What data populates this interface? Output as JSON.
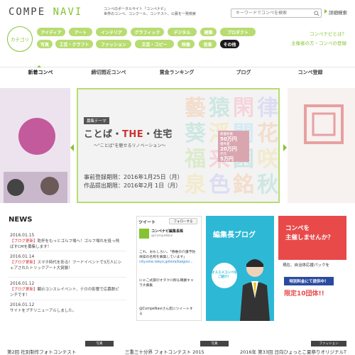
{
  "header": {
    "logo_main": "COMPE",
    "logo_accent": "NAVI",
    "tagline_1": "コンペのポータルサイト「コンペナビ」",
    "tagline_2": "世界のコンペ、コンクール、コンテスト、公募を一発検索",
    "search_placeholder": "キーワードでコンペを検索",
    "advanced_search": "詳細検索"
  },
  "category": {
    "label": "カテゴリ",
    "row1": [
      "アイディア",
      "アート",
      "インテリア",
      "グラフィック",
      "デジタル",
      "建築",
      "プロダクト"
    ],
    "row2": [
      "写真",
      "工芸・クラフト",
      "ファッション",
      "文芸・コピー",
      "映像",
      "音楽",
      "その他"
    ]
  },
  "side_links": {
    "about": "コンペナビとは？",
    "for_hosts": "主催者の方・コンペの登録"
  },
  "nav": [
    "新着コンペ",
    "締切間近コンペ",
    "賞金ランキング",
    "ブログ",
    "コンペ登録"
  ],
  "hero": {
    "tag": "募集テーマ",
    "title_a": "ことば",
    "title_b": "THE",
    "title_c": "住宅",
    "subtitle": "〜\"ことば\"を魅せるリノベーション〜",
    "date_1": "事前登録期限：2016年1月25日（月）",
    "date_2": "作品提出期限：2016年2月 1日（月）",
    "prize_1": "最優秀賞",
    "prize_1_val": "50万円",
    "prize_2": "優秀賞",
    "prize_2_val": "20万円",
    "prize_3": "佳作",
    "prize_3_val": "5万円"
  },
  "news": {
    "heading": "NEWS",
    "items": [
      {
        "date": "2016.01.15",
        "cat": "【ブログ更新】",
        "text": "乾杯をもっとゴルフ場へ！ゴルフ場れを投っ飛ばすCMを募集します！"
      },
      {
        "date": "2016.01.14",
        "cat": "【ブログ更新】",
        "text": "スマホ時代を彩る！フードイベントで3万人にシェアされたトリックアート大賞展！"
      },
      {
        "date": "2016.01.12",
        "cat": "【ブログ更新】",
        "text": "顕示コンスレイベント、テロの影響で応募数ピンチです！"
      },
      {
        "date": "2016.01.12",
        "cat": "",
        "text": "サイトをプチリニューアルしました。"
      }
    ]
  },
  "tweets": {
    "heading": "ツイート",
    "follow": "フォローする",
    "name": "コンペナビ編集長株",
    "handle": "@CompeNavi",
    "body": "これ、おもしろい。「香椎の介護予防体操の名称を募集しています」",
    "link": "city.ome.tokyo.jp/kore/kaigosi...",
    "retweet": "にゃこ式部＠オタク川柳＆職業キャラ大募集",
    "footer": "@CompeNaviさん宛にツイートする"
  },
  "blog_banner": {
    "title": "編集長ブログ",
    "bubble": "オススメコンペをご紹介！"
  },
  "host_banner": {
    "title_1": "コンペを",
    "title_2": "主催しませんか？",
    "panel_text_1": "現在、自治体応援パックを",
    "panel_text_2": "特別料金にて提供中！",
    "panel_big": "限定10団体!!"
  },
  "bottom": {
    "tags": [
      "写真",
      "写真",
      "ファッション"
    ],
    "titles": [
      "第2回 社別制作フォトコンテスト",
      "三重三十分界 フォトコンテスト 2015",
      "2016年 第33回 日向ひょっとこ夏祭りオリジナルT"
    ]
  },
  "colors": {
    "accent_green": "#86c232",
    "pill_green": "#b8dc71",
    "blog_blue": "#2db8d6",
    "host_red": "#e84a4a"
  }
}
